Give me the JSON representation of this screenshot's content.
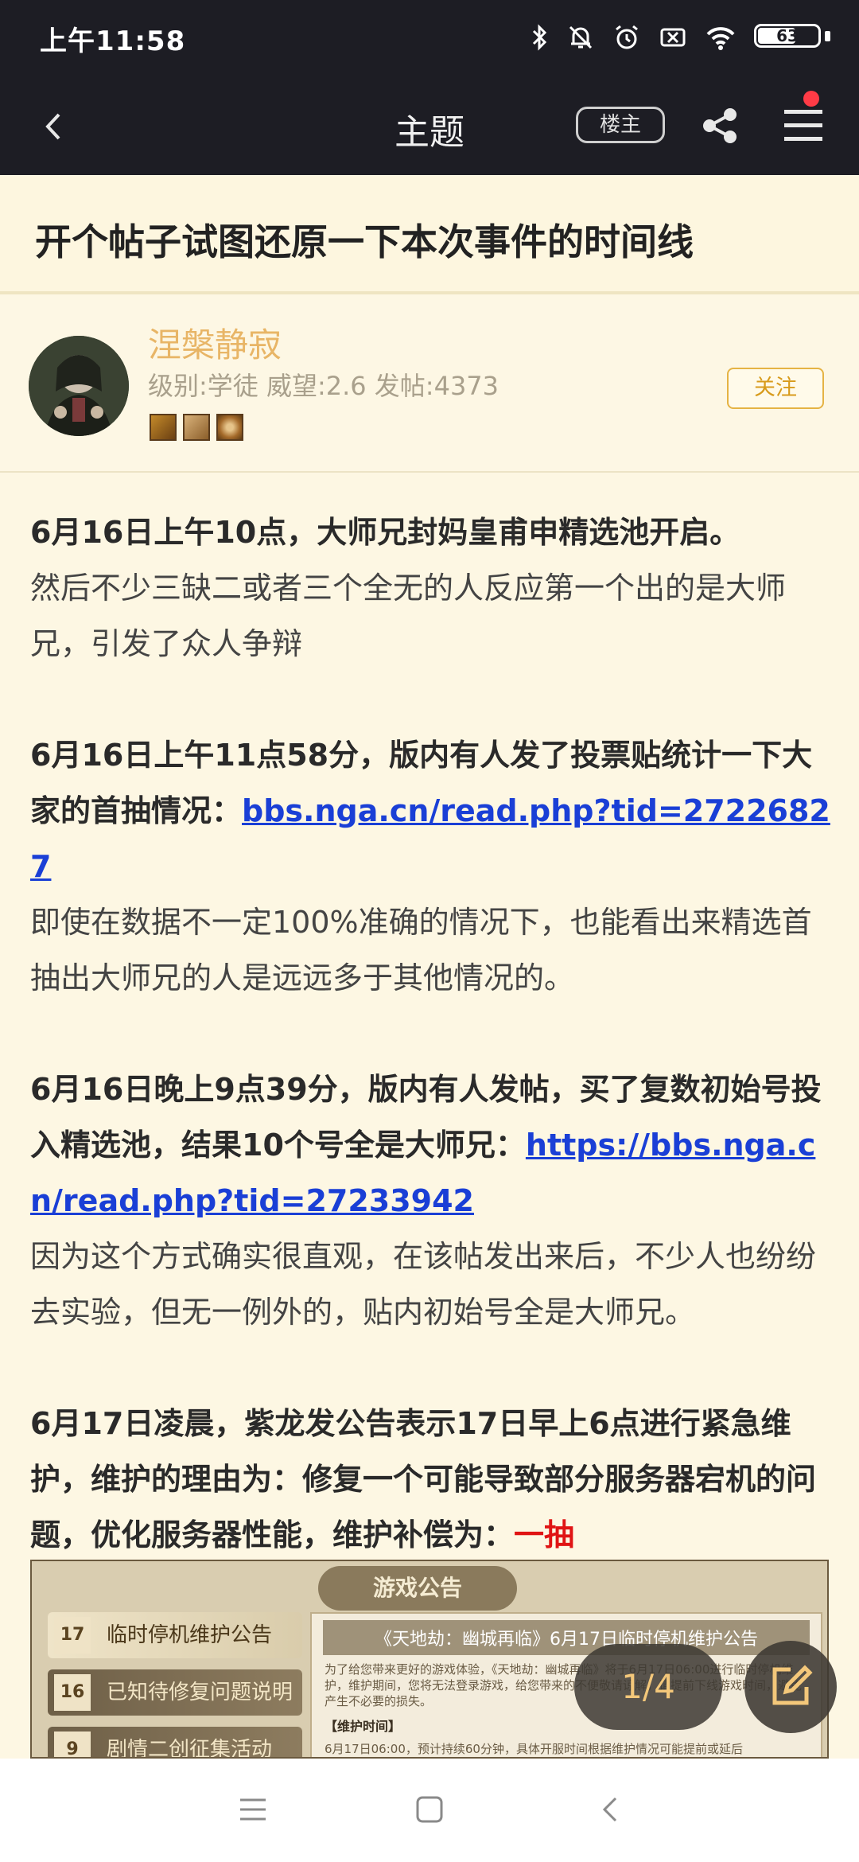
{
  "status_bar": {
    "time": "上午11:58",
    "battery": "63",
    "battery_level": 0.63,
    "icons": [
      "bluetooth-icon",
      "silent-bell-icon",
      "alarm-icon",
      "sim-off-icon",
      "wifi-icon",
      "battery-icon"
    ]
  },
  "header": {
    "title": "主题",
    "op_label": "楼主",
    "icons": [
      "back-icon",
      "share-icon",
      "menu-icon"
    ],
    "notification_dot_color": "#ff3b46"
  },
  "topic": {
    "title": "开个帖子试图还原一下本次事件的时间线"
  },
  "author": {
    "name": "涅槃静寂",
    "meta": "级别:学徒 威望:2.6 发帖:4373",
    "follow_label": "关注",
    "badge_icons": [
      "badge-icon-1",
      "badge-icon-2",
      "badge-icon-3"
    ]
  },
  "content": {
    "p1_bold": "6月16日上午10点，大师兄封妈皇甫申精选池开启。",
    "p1_text": "然后不少三缺二或者三个全无的人反应第一个出的是大师兄，引发了众人争辩",
    "p2_bold": "6月16日上午11点58分，版内有人发了投票贴统计一下大家的首抽情况：",
    "p2_link": "bbs.nga.cn/read.php?tid=27226827",
    "p2_text": "即使在数据不一定100%准确的情况下，也能看出来精选首抽出大师兄的人是远远多于其他情况的。",
    "p3_bold": "6月16日晚上9点39分，版内有人发帖，买了复数初始号投入精选池，结果10个号全是大师兄：",
    "p3_link": "https://bbs.nga.cn/read.php?tid=27233942",
    "p3_text": "因为这个方式确实很直观，在该帖发出来后，不少人也纷纷去实验，但无一例外的，贴内初始号全是大师兄。",
    "p4_bold": "6月17日凌晨，紫龙发公告表示17日早上6点进行紧急维护，维护的理由为：修复一个可能导致部分服务器宕机的问题，优化服务器性能，维护补偿为：",
    "p4_red": "一抽",
    "link_color": "#1a3fd6",
    "highlight_color": "#e01414"
  },
  "notice_image": {
    "banner": "游戏公告",
    "items": [
      {
        "date": "17",
        "label": "临时停机维护公告"
      },
      {
        "date": "16",
        "label": "已知待修复问题说明"
      },
      {
        "date": "9",
        "label": "剧情二创征集活动"
      }
    ],
    "doc_title": "《天地劫：幽城再临》6月17日临时停机维护公告",
    "doc_body": "为了给您带来更好的游戏体验，《天地劫：幽城再临》将于6月17日06:00进行临时停机维护，维护期间，您将无法登录游戏，给您带来的不便敬请谅解，请提前下线游戏时间，避免产生不必要的损失。",
    "doc_sub": "【维护时间】",
    "doc_line": "6月17日06:00，预计持续60分钟，具体开服时间根据维护情况可能提前或延后"
  },
  "floating": {
    "page_indicator": "1/4",
    "edit_icon": "edit-icon"
  },
  "nav_bar": {
    "icons": [
      "recents-icon",
      "home-icon",
      "back-nav-icon"
    ]
  }
}
